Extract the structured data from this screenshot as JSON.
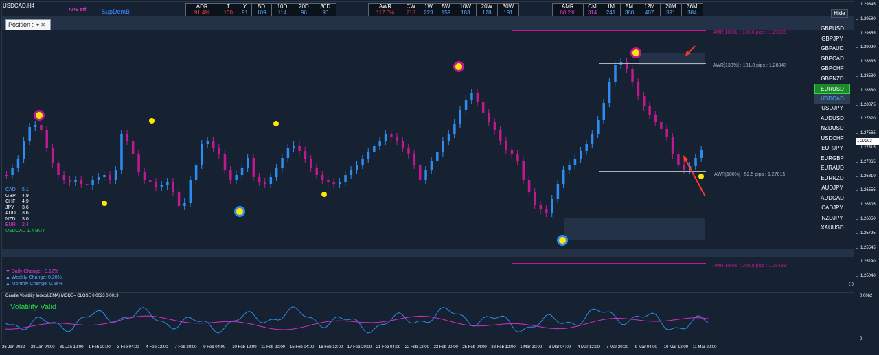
{
  "chart": {
    "symbol_title": "USDCAD,H4",
    "aps_label": "APS off",
    "supdem_label": "SupDemB"
  },
  "position_panel": {
    "label": "Position :",
    "controls": "▾ ✕"
  },
  "table_daily": {
    "headers": [
      "ADR",
      "T",
      "Y",
      "5D",
      "10D",
      "20D",
      "30D"
    ],
    "values": [
      "91.4%",
      "100",
      "91",
      "109",
      "114",
      "96",
      "90"
    ],
    "colors": [
      "#ff3a3a",
      "#ff3a3a",
      "#5aa9ff",
      "#5aa9ff",
      "#5aa9ff",
      "#5aa9ff",
      "#5aa9ff"
    ]
  },
  "table_weekly": {
    "headers": [
      "AWR",
      "CW",
      "1W",
      "5W",
      "10W",
      "20W",
      "30W"
    ],
    "values": [
      "117.6%",
      "218",
      "223",
      "159",
      "183",
      "178",
      "191"
    ],
    "colors": [
      "#ff3a3a",
      "#ff3a3a",
      "#5aa9ff",
      "#5aa9ff",
      "#5aa9ff",
      "#5aa9ff",
      "#5aa9ff"
    ]
  },
  "table_monthly": {
    "headers": [
      "AMR",
      "CM",
      "1M",
      "5M",
      "12M",
      "20M",
      "36M"
    ],
    "values": [
      "80.2%",
      "314",
      "241",
      "380",
      "407",
      "391",
      "384"
    ],
    "colors": [
      "#e23ad8",
      "#e23ad8",
      "#5aa9ff",
      "#5aa9ff",
      "#5aa9ff",
      "#5aa9ff",
      "#5aa9ff"
    ]
  },
  "levels": {
    "amr_upper": "AMR[100%] : 186.6 pips : 1.29395",
    "awr_upper": "AWR[130%] : 131.8 pips : 1.28847",
    "awr_lower": "AWR[100%] : 52.5 pips : 1.27015",
    "amr_lower": "AMR[100%] : 205.8 pips : 1.25483"
  },
  "hide_button": "Hide",
  "pairs": [
    "GBPUSD",
    "GBPJPY",
    "GBPAUD",
    "GBPCAD",
    "GBPCHF",
    "GBPNZD",
    "EURUSD",
    "USDCAD",
    "USDJPY",
    "AUDUSD",
    "NZDUSD",
    "USDCHF",
    "EURJPY",
    "EURGBP",
    "EURAUD",
    "EURNZD",
    "AUDJPY",
    "AUDCAD",
    "CADJPY",
    "NZDJPY",
    "XAUUSD"
  ],
  "active_pair": "EURUSD",
  "current_pair": "USDCAD",
  "current_price": "1.27292",
  "price_ticks": [
    "1.29845",
    "1.29580",
    "1.29355",
    "1.29090",
    "1.28835",
    "1.28580",
    "1.28330",
    "1.28075",
    "1.27820",
    "1.27565",
    "1.27315",
    "1.27065",
    "1.26810",
    "1.26555",
    "1.26305",
    "1.26050",
    "1.25795",
    "1.25545",
    "1.25290",
    "1.25040"
  ],
  "strength": [
    {
      "ccy": "CAD",
      "val": "5.1",
      "color": "#5aa9ff"
    },
    {
      "ccy": "GBP",
      "val": "4.9",
      "color": "#ffffff"
    },
    {
      "ccy": "CHF",
      "val": "4.9",
      "color": "#ffffff"
    },
    {
      "ccy": "JPY",
      "val": "3.6",
      "color": "#ffffff"
    },
    {
      "ccy": "AUD",
      "val": "3.6",
      "color": "#ffffff"
    },
    {
      "ccy": "NZD",
      "val": "3.0",
      "color": "#ffffff"
    },
    {
      "ccy": "EUR",
      "val": "2.4",
      "color": "#e23ad8"
    }
  ],
  "signal": "USDCAD 1.4 BUY",
  "changes": {
    "daily": "Daily Change: -0.12%",
    "weekly": "Weekly Change: 0.20%",
    "monthly": "Monthly Change: 0.66%"
  },
  "indicator": {
    "title": "Candle Volatility Index(LEMA) MODE= CLOSE 0.0023 0.0019",
    "status": "Volatility Valid",
    "axis_top": "0.0062",
    "axis_bottom": "0"
  },
  "time_ticks": [
    "26 Jan 2022",
    "28 Jan 04:00",
    "31 Jan 12:00",
    "1 Feb 20:00",
    "3 Feb 04:00",
    "4 Feb 12:00",
    "7 Feb 20:00",
    "9 Feb 04:00",
    "10 Feb 12:00",
    "11 Feb 20:00",
    "15 Feb 04:00",
    "16 Feb 12:00",
    "17 Feb 20:00",
    "21 Feb 04:00",
    "22 Feb 12:00",
    "23 Feb 20:00",
    "25 Feb 04:00",
    "28 Feb 12:00",
    "1 Mar 20:00",
    "3 Mar 04:00",
    "4 Mar 12:00",
    "7 Mar 20:00",
    "9 Mar 04:00",
    "10 Mar 12:00",
    "11 Mar 20:00"
  ],
  "colors": {
    "bull": "#2d8cf0",
    "bear": "#c2188f",
    "background": "#162232",
    "zone": "#233246",
    "amr_line": "#c2188f",
    "awr_line": "#aab4c0",
    "marker": "#ffe600",
    "arrow": "#ff3a2a"
  }
}
